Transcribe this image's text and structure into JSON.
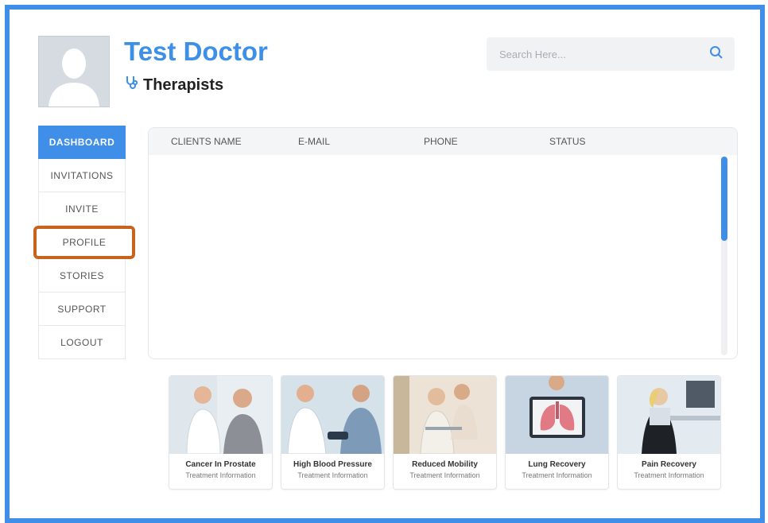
{
  "header": {
    "doctor_name": "Test Doctor",
    "role": "Therapists",
    "role_icon": "stethoscope-icon"
  },
  "search": {
    "placeholder": "Search Here...",
    "icon": "search-icon"
  },
  "nav": {
    "items": [
      {
        "label": "DASHBOARD",
        "active": true
      },
      {
        "label": "INVITATIONS"
      },
      {
        "label": "INVITE"
      },
      {
        "label": "PROFILE",
        "highlighted": true
      },
      {
        "label": "STORIES"
      },
      {
        "label": "SUPPORT"
      },
      {
        "label": "LOGOUT"
      }
    ]
  },
  "table": {
    "columns": [
      "CLIENTS NAME",
      "E-MAIL",
      "PHONE",
      "STATUS"
    ],
    "rows": []
  },
  "cards": [
    {
      "title": "Cancer In Prostate",
      "subtitle": "Treatment Information"
    },
    {
      "title": "High Blood Pressure",
      "subtitle": "Treatment Information"
    },
    {
      "title": "Reduced Mobility",
      "subtitle": "Treatment Information"
    },
    {
      "title": "Lung Recovery",
      "subtitle": "Treatment Information"
    },
    {
      "title": "Pain Recovery",
      "subtitle": "Treatment Information"
    }
  ],
  "colors": {
    "accent": "#3f8ee8",
    "highlight": "#c8631e"
  }
}
